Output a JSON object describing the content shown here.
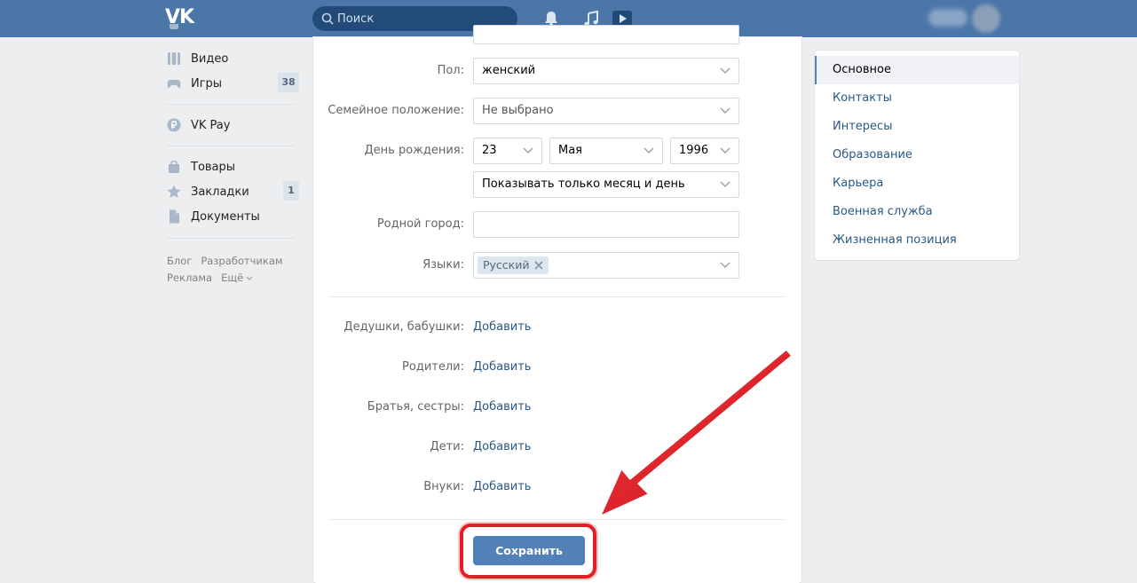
{
  "header": {
    "logo": "VK",
    "search_placeholder": "Поиск"
  },
  "sidebar": {
    "items": [
      {
        "label": "Видео",
        "icon": "video-icon"
      },
      {
        "label": "Игры",
        "icon": "games-icon",
        "count": "38"
      },
      {
        "label": "VK Pay",
        "icon": "vkpay-icon"
      },
      {
        "label": "Товары",
        "icon": "goods-icon"
      },
      {
        "label": "Закладки",
        "icon": "bookmarks-icon",
        "count": "1"
      },
      {
        "label": "Документы",
        "icon": "documents-icon"
      }
    ],
    "footer": [
      "Блог",
      "Разработчикам",
      "Реклама",
      "Ещё"
    ]
  },
  "form": {
    "gender": {
      "label": "Пол:",
      "value": "женский"
    },
    "relationship": {
      "label": "Семейное положение:",
      "value": "Не выбрано"
    },
    "birthday": {
      "label": "День рождения:",
      "day": "23",
      "month": "Мая",
      "year": "1996",
      "visibility": "Показывать только месяц и день"
    },
    "hometown": {
      "label": "Родной город:",
      "value": ""
    },
    "languages": {
      "label": "Языки:",
      "tag": "Русский"
    },
    "relatives": [
      {
        "label": "Дедушки, бабушки:",
        "action": "Добавить"
      },
      {
        "label": "Родители:",
        "action": "Добавить"
      },
      {
        "label": "Братья, сестры:",
        "action": "Добавить"
      },
      {
        "label": "Дети:",
        "action": "Добавить"
      },
      {
        "label": "Внуки:",
        "action": "Добавить"
      }
    ],
    "save_label": "Сохранить"
  },
  "right_menu": {
    "items": [
      "Основное",
      "Контакты",
      "Интересы",
      "Образование",
      "Карьера",
      "Военная служба",
      "Жизненная позиция"
    ],
    "active": "Основное"
  },
  "colors": {
    "header": "#4a76a8",
    "link": "#2a5885",
    "button": "#5181b8",
    "highlight": "#e31e24"
  }
}
